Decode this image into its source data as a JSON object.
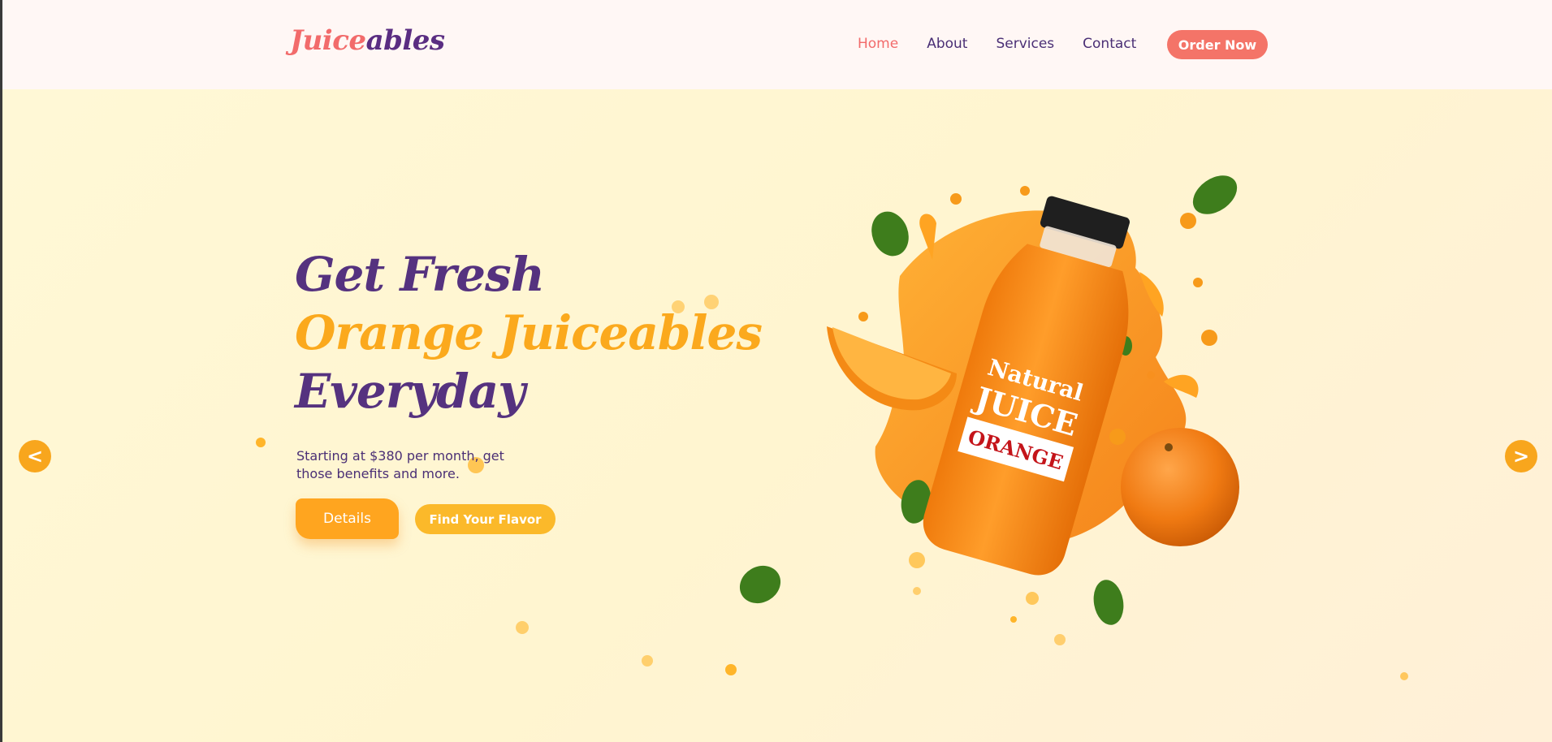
{
  "brand": {
    "logo_part1": "Juice",
    "logo_part2": "ables"
  },
  "nav": {
    "links": [
      {
        "label": "Home",
        "active": true
      },
      {
        "label": "About"
      },
      {
        "label": "Services"
      },
      {
        "label": "Contact"
      }
    ],
    "cta": "Order Now"
  },
  "hero": {
    "headline_line1": "Get Fresh",
    "headline_line2": "Orange Juiceables",
    "headline_line3": "Everyday",
    "subtitle": "Starting at $380 per month, get those benefits and more.",
    "primary_button": "Details",
    "secondary_button": "Find Your Flavor"
  },
  "carousel": {
    "prev": "<",
    "next": ">"
  },
  "product": {
    "label_line1": "Natural",
    "label_line2": "JUICE",
    "label_line3": "ORANGE"
  },
  "colors": {
    "accent_coral": "#f26b6b",
    "brand_purple": "#55327f",
    "accent_orange": "#fba91d",
    "hero_bg": "#fff7d6"
  }
}
